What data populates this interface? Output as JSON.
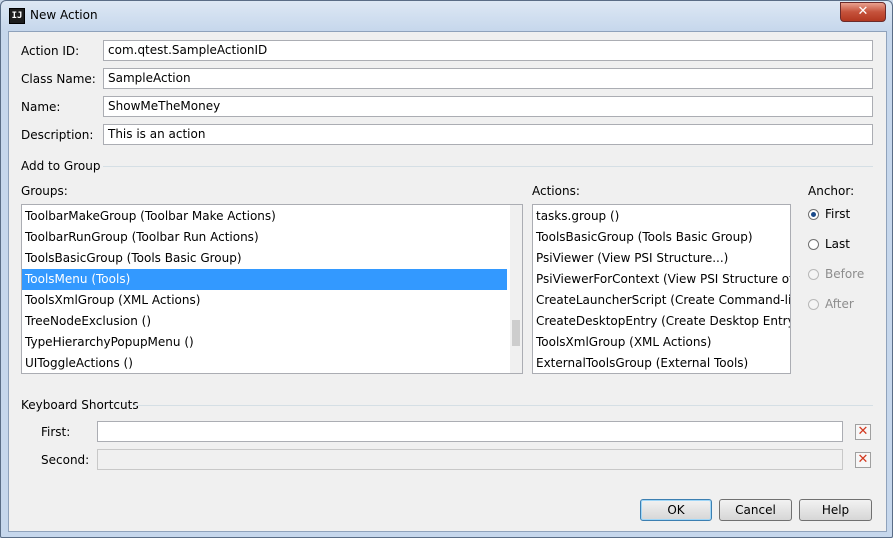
{
  "window": {
    "title": "New Action",
    "app_icon_text": "IJ",
    "close_symbol": "✕"
  },
  "form": {
    "action_id": {
      "label": "Action ID:",
      "value": "com.qtest.SampleActionID"
    },
    "class_name": {
      "label": "Class Name:",
      "value": "SampleAction"
    },
    "name": {
      "label": "Name:",
      "value": "ShowMeTheMoney"
    },
    "description": {
      "label": "Description:",
      "value": "This is an action"
    }
  },
  "add_to_group": {
    "section_label": "Add to Group",
    "groups_label": "Groups:",
    "groups": [
      "ToolbarMakeGroup (Toolbar Make Actions)",
      "ToolbarRunGroup (Toolbar Run Actions)",
      "ToolsBasicGroup (Tools Basic Group)",
      "ToolsMenu (Tools)",
      "ToolsXmlGroup (XML Actions)",
      "TreeNodeExclusion ()",
      "TypeHierarchyPopupMenu ()",
      "UIToggleActions ()"
    ],
    "selected_group": "ToolsMenu (Tools)",
    "actions_label": "Actions:",
    "actions": [
      "tasks.group ()",
      "ToolsBasicGroup (Tools Basic Group)",
      "PsiViewer (View PSI Structure...)",
      "PsiViewerForContext (View PSI Structure of Current Element...)",
      "CreateLauncherScript (Create Command-line Launcher...)",
      "CreateDesktopEntry (Create Desktop Entry...)",
      "ToolsXmlGroup (XML Actions)",
      "ExternalToolsGroup (External Tools)"
    ],
    "anchor_label": "Anchor:",
    "anchors": [
      "First",
      "Last",
      "Before",
      "After"
    ],
    "selected_anchor": "First"
  },
  "shortcuts": {
    "section_label": "Keyboard Shortcuts",
    "first_label": "First:",
    "first_value": "",
    "second_label": "Second:",
    "second_value": "",
    "clear_symbol": "✕"
  },
  "buttons": {
    "ok": "OK",
    "cancel": "Cancel",
    "help": "Help"
  }
}
